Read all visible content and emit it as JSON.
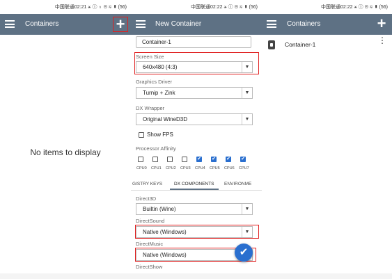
{
  "status": {
    "left": "中国联通02:21 ⚹ ⓘ ♁ ⊜ ≋ ▮ (56)",
    "middle": "中国联通02:22 ⚹ ⓘ ⊜ ≋ ▮ (56)",
    "right": "中国联通02:22 ⚹ ⓘ ⊜ ≋ ▮ (56)"
  },
  "panel1": {
    "title": "Containers",
    "add_label": "+",
    "empty_text": "No items to display"
  },
  "panel2": {
    "title": "New Container",
    "name_value": "Container-1",
    "screen_size": {
      "label": "Screen Size",
      "value": "640x480 (4:3)"
    },
    "graphics_driver": {
      "label": "Graphics Driver",
      "value": "Turnip + Zink"
    },
    "dx_wrapper": {
      "label": "DX Wrapper",
      "value": "Original WineD3D"
    },
    "show_fps": {
      "label": "Show FPS",
      "checked": false
    },
    "processor_affinity": {
      "label": "Processor Affinity",
      "cpus": [
        {
          "name": "CPU0",
          "checked": false
        },
        {
          "name": "CPU1",
          "checked": false
        },
        {
          "name": "CPU2",
          "checked": false
        },
        {
          "name": "CPU3",
          "checked": false
        },
        {
          "name": "CPU4",
          "checked": true
        },
        {
          "name": "CPU5",
          "checked": true
        },
        {
          "name": "CPU6",
          "checked": true
        },
        {
          "name": "CPU7",
          "checked": true
        }
      ]
    },
    "tabs": [
      "GISTRY KEYS",
      "DX COMPONENTS",
      "ENVIRONME"
    ],
    "direct3d": {
      "label": "Direct3D",
      "value": "Builtin (Wine)"
    },
    "directsound": {
      "label": "DirectSound",
      "value": "Native (Windows)"
    },
    "directmusic": {
      "label": "DirectMusic",
      "value": "Native (Windows)"
    },
    "directshow": {
      "label": "DirectShow"
    },
    "fab_icon": "check-icon",
    "dropdown_arrow": "▼",
    "check_glyph": "✔"
  },
  "panel3": {
    "title": "Containers",
    "add_label": "+",
    "items": [
      {
        "name": "Container-1"
      }
    ],
    "more_glyph": "⋮"
  },
  "colors": {
    "appbar": "#5e7184",
    "accent": "#2a6fcf",
    "highlight": "#e02020"
  }
}
